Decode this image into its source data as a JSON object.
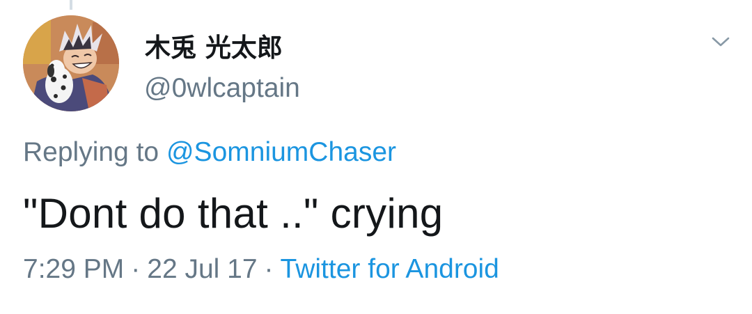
{
  "tweet": {
    "author": {
      "display_name": "木兎 光太郎",
      "handle": "@0wlcaptain",
      "avatar_icon": "anime-character-avatar"
    },
    "menu_icon": "chevron-down-icon",
    "reply": {
      "prefix": "Replying to",
      "mention": "@SomniumChaser"
    },
    "text": "\"Dont do that ..\" crying",
    "meta": {
      "time": "7:29 PM",
      "separator": "·",
      "date": "22 Jul 17",
      "source": "Twitter for Android"
    }
  },
  "colors": {
    "primary_text": "#14171a",
    "secondary_text": "#657786",
    "link": "#1b95e0",
    "thread_line": "#d4dde4"
  }
}
